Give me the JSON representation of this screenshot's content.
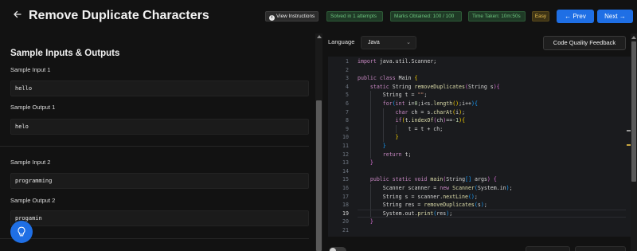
{
  "header": {
    "back_icon": "arrow-left-icon",
    "title": "Remove Duplicate Characters",
    "view_instructions": "View Instructions",
    "info_icon": "info-icon",
    "solved": "Solved in 1 attempts",
    "marks": "Marks Obtained: 100 / 100",
    "time": "Time Taken: 10m:50s",
    "difficulty": "Easy",
    "prev_label": "← Prev",
    "next_label": "Next →",
    "colors": {
      "accent": "#1f6fe5",
      "success": "#6cc37e",
      "warning": "#e8bf4f"
    }
  },
  "samples": {
    "section_title": "Sample Inputs & Outputs",
    "items": [
      {
        "input_label": "Sample Input 1",
        "input": "hello",
        "output_label": "Sample Output 1",
        "output": "helo"
      },
      {
        "input_label": "Sample Input 2",
        "input": "programming",
        "output_label": "Sample Output 2",
        "output": "progamin"
      }
    ]
  },
  "hint_button": {
    "icon": "lightbulb-icon"
  },
  "editor": {
    "language_label": "Language",
    "language": "Java",
    "code_quality_label": "Code Quality Feedback",
    "active_line": 19,
    "lines": [
      [
        [
          "kw",
          "import"
        ],
        [
          "pl",
          " java.util.Scanner;"
        ]
      ],
      [],
      [
        [
          "kw",
          "public"
        ],
        [
          "pl",
          " "
        ],
        [
          "kw",
          "class"
        ],
        [
          "pl",
          " Main "
        ],
        [
          "b1",
          "{"
        ]
      ],
      [
        [
          "pl",
          "    "
        ],
        [
          "kw",
          "static"
        ],
        [
          "pl",
          " String "
        ],
        [
          "fn",
          "removeDuplicates"
        ],
        [
          "b2",
          "("
        ],
        [
          "pl",
          "String s"
        ],
        [
          "b2",
          ")"
        ],
        [
          "b2",
          "{"
        ]
      ],
      [
        [
          "pl",
          "        String t = "
        ],
        [
          "str",
          "\"\""
        ],
        [
          "pl",
          ";"
        ]
      ],
      [
        [
          "pl",
          "        "
        ],
        [
          "kw",
          "for"
        ],
        [
          "b3",
          "("
        ],
        [
          "kw",
          "int"
        ],
        [
          "pl",
          " i="
        ],
        [
          "num",
          "0"
        ],
        [
          "pl",
          ";i<s."
        ],
        [
          "fn",
          "length"
        ],
        [
          "b1",
          "()"
        ],
        [
          "pl",
          ";i++"
        ],
        [
          "b3",
          ")"
        ],
        [
          "b3",
          "{"
        ]
      ],
      [
        [
          "pl",
          "            "
        ],
        [
          "kw",
          "char"
        ],
        [
          "pl",
          " ch = s."
        ],
        [
          "fn",
          "charAt"
        ],
        [
          "b1",
          "("
        ],
        [
          "pl",
          "i"
        ],
        [
          "b1",
          ")"
        ],
        [
          "pl",
          ";"
        ]
      ],
      [
        [
          "pl",
          "            "
        ],
        [
          "kw",
          "if"
        ],
        [
          "b1",
          "("
        ],
        [
          "pl",
          "t."
        ],
        [
          "fn",
          "indexOf"
        ],
        [
          "b2",
          "("
        ],
        [
          "pl",
          "ch"
        ],
        [
          "b2",
          ")"
        ],
        [
          "pl",
          "=="
        ],
        [
          "num",
          "-1"
        ],
        [
          "b1",
          ")"
        ],
        [
          "b1",
          "{"
        ]
      ],
      [
        [
          "pl",
          "                t = t + ch;"
        ]
      ],
      [
        [
          "pl",
          "            "
        ],
        [
          "b1",
          "}"
        ]
      ],
      [
        [
          "pl",
          "        "
        ],
        [
          "b3",
          "}"
        ]
      ],
      [
        [
          "pl",
          "        "
        ],
        [
          "kw",
          "return"
        ],
        [
          "pl",
          " t;"
        ]
      ],
      [
        [
          "pl",
          "    "
        ],
        [
          "b2",
          "}"
        ]
      ],
      [],
      [
        [
          "pl",
          "    "
        ],
        [
          "kw",
          "public"
        ],
        [
          "pl",
          " "
        ],
        [
          "kw",
          "static"
        ],
        [
          "pl",
          " "
        ],
        [
          "kw",
          "void"
        ],
        [
          "pl",
          " "
        ],
        [
          "fn",
          "main"
        ],
        [
          "b2",
          "("
        ],
        [
          "pl",
          "String"
        ],
        [
          "b3",
          "[]"
        ],
        [
          "pl",
          " args"
        ],
        [
          "b2",
          ")"
        ],
        [
          "pl",
          " "
        ],
        [
          "b2",
          "{"
        ]
      ],
      [
        [
          "pl",
          "        Scanner scanner = "
        ],
        [
          "kw",
          "new"
        ],
        [
          "pl",
          " "
        ],
        [
          "fn",
          "Scanner"
        ],
        [
          "b3",
          "("
        ],
        [
          "pl",
          "System.in"
        ],
        [
          "b3",
          ")"
        ],
        [
          "pl",
          ";"
        ]
      ],
      [
        [
          "pl",
          "        String s = scanner."
        ],
        [
          "fn",
          "nextLine"
        ],
        [
          "b3",
          "()"
        ],
        [
          "pl",
          ";"
        ]
      ],
      [
        [
          "pl",
          "        String res = "
        ],
        [
          "fn",
          "removeDuplicates"
        ],
        [
          "b3",
          "("
        ],
        [
          "pl",
          "s"
        ],
        [
          "b3",
          ")"
        ],
        [
          "pl",
          ";"
        ]
      ],
      [
        [
          "pl",
          "        System.out."
        ],
        [
          "fn",
          "print"
        ],
        [
          "b3",
          "("
        ],
        [
          "pl",
          "res"
        ],
        [
          "b3",
          ")"
        ],
        [
          "pl",
          ";"
        ]
      ],
      [
        [
          "pl",
          "    "
        ],
        [
          "b2",
          "}"
        ]
      ],
      [],
      []
    ]
  }
}
